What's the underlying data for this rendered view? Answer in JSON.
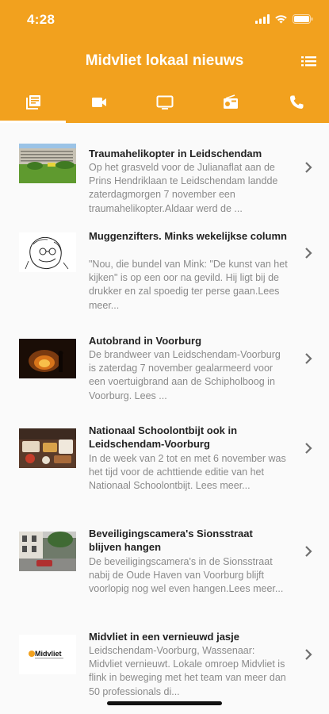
{
  "status": {
    "time": "4:28"
  },
  "header": {
    "title": "Midvliet lokaal nieuws",
    "menu_icon": "list-menu-icon"
  },
  "tabs": [
    {
      "name": "news",
      "icon": "newspaper-icon",
      "active": true
    },
    {
      "name": "video",
      "icon": "video-camera-icon",
      "active": false
    },
    {
      "name": "tv",
      "icon": "tv-icon",
      "active": false
    },
    {
      "name": "radio",
      "icon": "radio-icon",
      "active": false
    },
    {
      "name": "phone",
      "icon": "phone-icon",
      "active": false
    }
  ],
  "articles": [
    {
      "title": "Traumahelikopter in Leidschendam",
      "text": "Op het grasveld voor de Julianaflat aan de Prins Hendriklaan te Leidschendam landde zaterdagmorgen 7 november een traumahelikopter.Aldaar werd de ..."
    },
    {
      "title": "Muggenzifters. Minks wekelijkse column",
      "text": "\"Nou, die bundel van Mink: \"De kunst van het kijken\" is op een oor na gevild. Hij ligt bij de drukker en zal spoedig ter perse gaan.Lees meer..."
    },
    {
      "title": "Autobrand in Voorburg",
      "text": "De brandweer van Leidschendam-Voorburg is zaterdag 7 november gealarmeerd voor een voertuigbrand aan de Schipholboog in Voorburg. Lees ..."
    },
    {
      "title": "Nationaal Schoolontbijt ook in Leidschendam-Voorburg",
      "text": "In de week van 2 tot en met 6 november was het tijd voor de achttiende editie van het Nationaal Schoolontbijt. Lees meer..."
    },
    {
      "title": "Beveiligingscamera's Sionsstraat blijven hangen",
      "text": "De beveiligingscamera's in de Sionsstraat nabij de Oude Haven van Voorburg blijft voorlopig nog wel even hangen.Lees meer..."
    },
    {
      "title": "Midvliet in een vernieuwd jasje",
      "text": "Leidschendam-Voorburg, Wassenaar: Midvliet vernieuwt. Lokale omroep Midvliet is flink in beweging met het team van meer dan 50 professionals di...",
      "logo_text": "Midvliet"
    }
  ],
  "colors": {
    "accent": "#f2a11e",
    "title_text": "#222222",
    "body_text": "#8a8a8a",
    "chevron": "#6f6f6f"
  }
}
